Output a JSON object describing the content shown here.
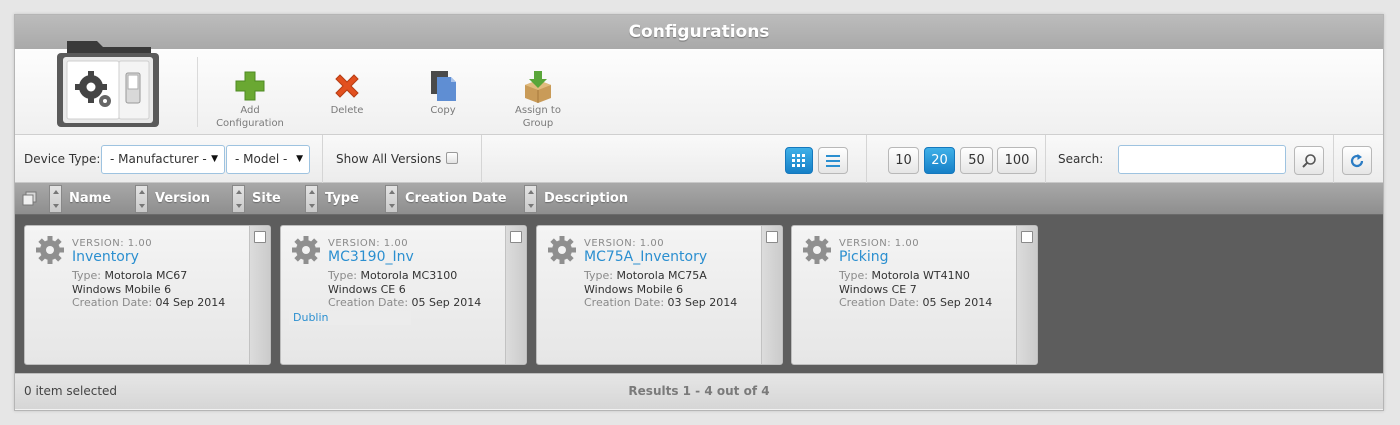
{
  "window": {
    "title": "Configurations"
  },
  "toolbar": {
    "add_line1": "Add",
    "add_line2": "Configuration",
    "delete": "Delete",
    "copy": "Copy",
    "assign_line1": "Assign to",
    "assign_line2": "Group"
  },
  "filters": {
    "device_type_label": "Device Type:",
    "manufacturer": "- Manufacturer -",
    "model": "- Model -",
    "show_all_versions": "Show All Versions",
    "page_sizes": [
      "10",
      "20",
      "50",
      "100"
    ],
    "selected_page_size": "20",
    "search_label": "Search:",
    "search_value": ""
  },
  "columns": [
    "Name",
    "Version",
    "Site",
    "Type",
    "Creation Date",
    "Description"
  ],
  "cards": [
    {
      "version": "VERSION: 1.00",
      "name": "Inventory",
      "type_key": "Type:",
      "type": "Motorola MC67",
      "os": "Windows Mobile 6",
      "date_key": "Creation Date:",
      "date": "04 Sep 2014",
      "site": ""
    },
    {
      "version": "VERSION: 1.00",
      "name": "MC3190_Inv",
      "type_key": "Type:",
      "type": "Motorola MC3100",
      "os": "Windows CE 6",
      "date_key": "Creation Date:",
      "date": "05 Sep 2014",
      "site": "Dublin"
    },
    {
      "version": "VERSION: 1.00",
      "name": "MC75A_Inventory",
      "type_key": "Type:",
      "type": "Motorola MC75A",
      "os": "Windows Mobile 6",
      "date_key": "Creation Date:",
      "date": "03 Sep 2014",
      "site": ""
    },
    {
      "version": "VERSION: 1.00",
      "name": "Picking",
      "type_key": "Type:",
      "type": "Motorola WT41N0",
      "os": "Windows CE 7",
      "date_key": "Creation Date:",
      "date": "05 Sep 2014",
      "site": ""
    }
  ],
  "status": {
    "selected": "0 item selected",
    "results": "Results 1 - 4 out of 4"
  },
  "colors": {
    "accent": "#2b8fd0",
    "active_button": "#1680c7"
  }
}
